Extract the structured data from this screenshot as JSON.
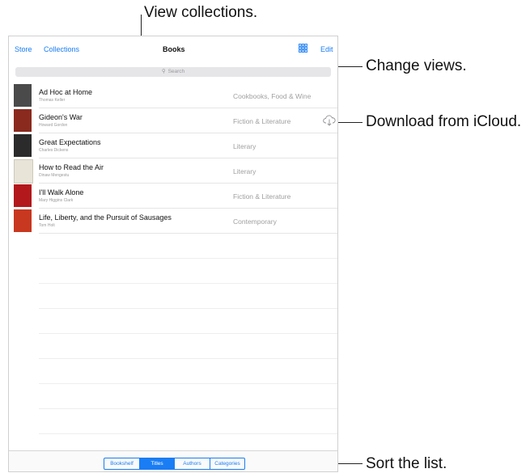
{
  "callouts": {
    "view_collections": "View collections.",
    "change_views": "Change views.",
    "download_icloud": "Download from iCloud.",
    "sort_list": "Sort the list."
  },
  "navbar": {
    "store": "Store",
    "collections": "Collections",
    "title": "Books",
    "edit": "Edit",
    "grid_icon": "grid-view-icon"
  },
  "search": {
    "placeholder": "Search",
    "icon": "search-icon"
  },
  "books": [
    {
      "title": "Ad Hoc at Home",
      "author": "Thomas Keller",
      "category": "Cookbooks, Food & Wine",
      "cover_color": "#4a4a4a"
    },
    {
      "title": "Gideon's War",
      "author": "Howard Gordon",
      "category": "Fiction & Literature",
      "cover_color": "#8a2a1e"
    },
    {
      "title": "Great Expectations",
      "author": "Charles Dickens",
      "category": "Literary",
      "cover_color": "#2b2b2b"
    },
    {
      "title": "How to Read the Air",
      "author": "Dinaw Mengestu",
      "category": "Literary",
      "cover_color": "#e8e4d8"
    },
    {
      "title": "I'll Walk Alone",
      "author": "Mary Higgins Clark",
      "category": "Fiction & Literature",
      "cover_color": "#b3181c"
    },
    {
      "title": "Life, Liberty, and the Pursuit of Sausages",
      "author": "Tom Holt",
      "category": "Contemporary",
      "cover_color": "#c8371f"
    }
  ],
  "download_icon": "cloud-download-icon",
  "toolbar": {
    "segments": [
      "Bookshelf",
      "Titles",
      "Authors",
      "Categories"
    ],
    "selected": "Titles"
  },
  "colors": {
    "accent": "#1a7df4"
  }
}
